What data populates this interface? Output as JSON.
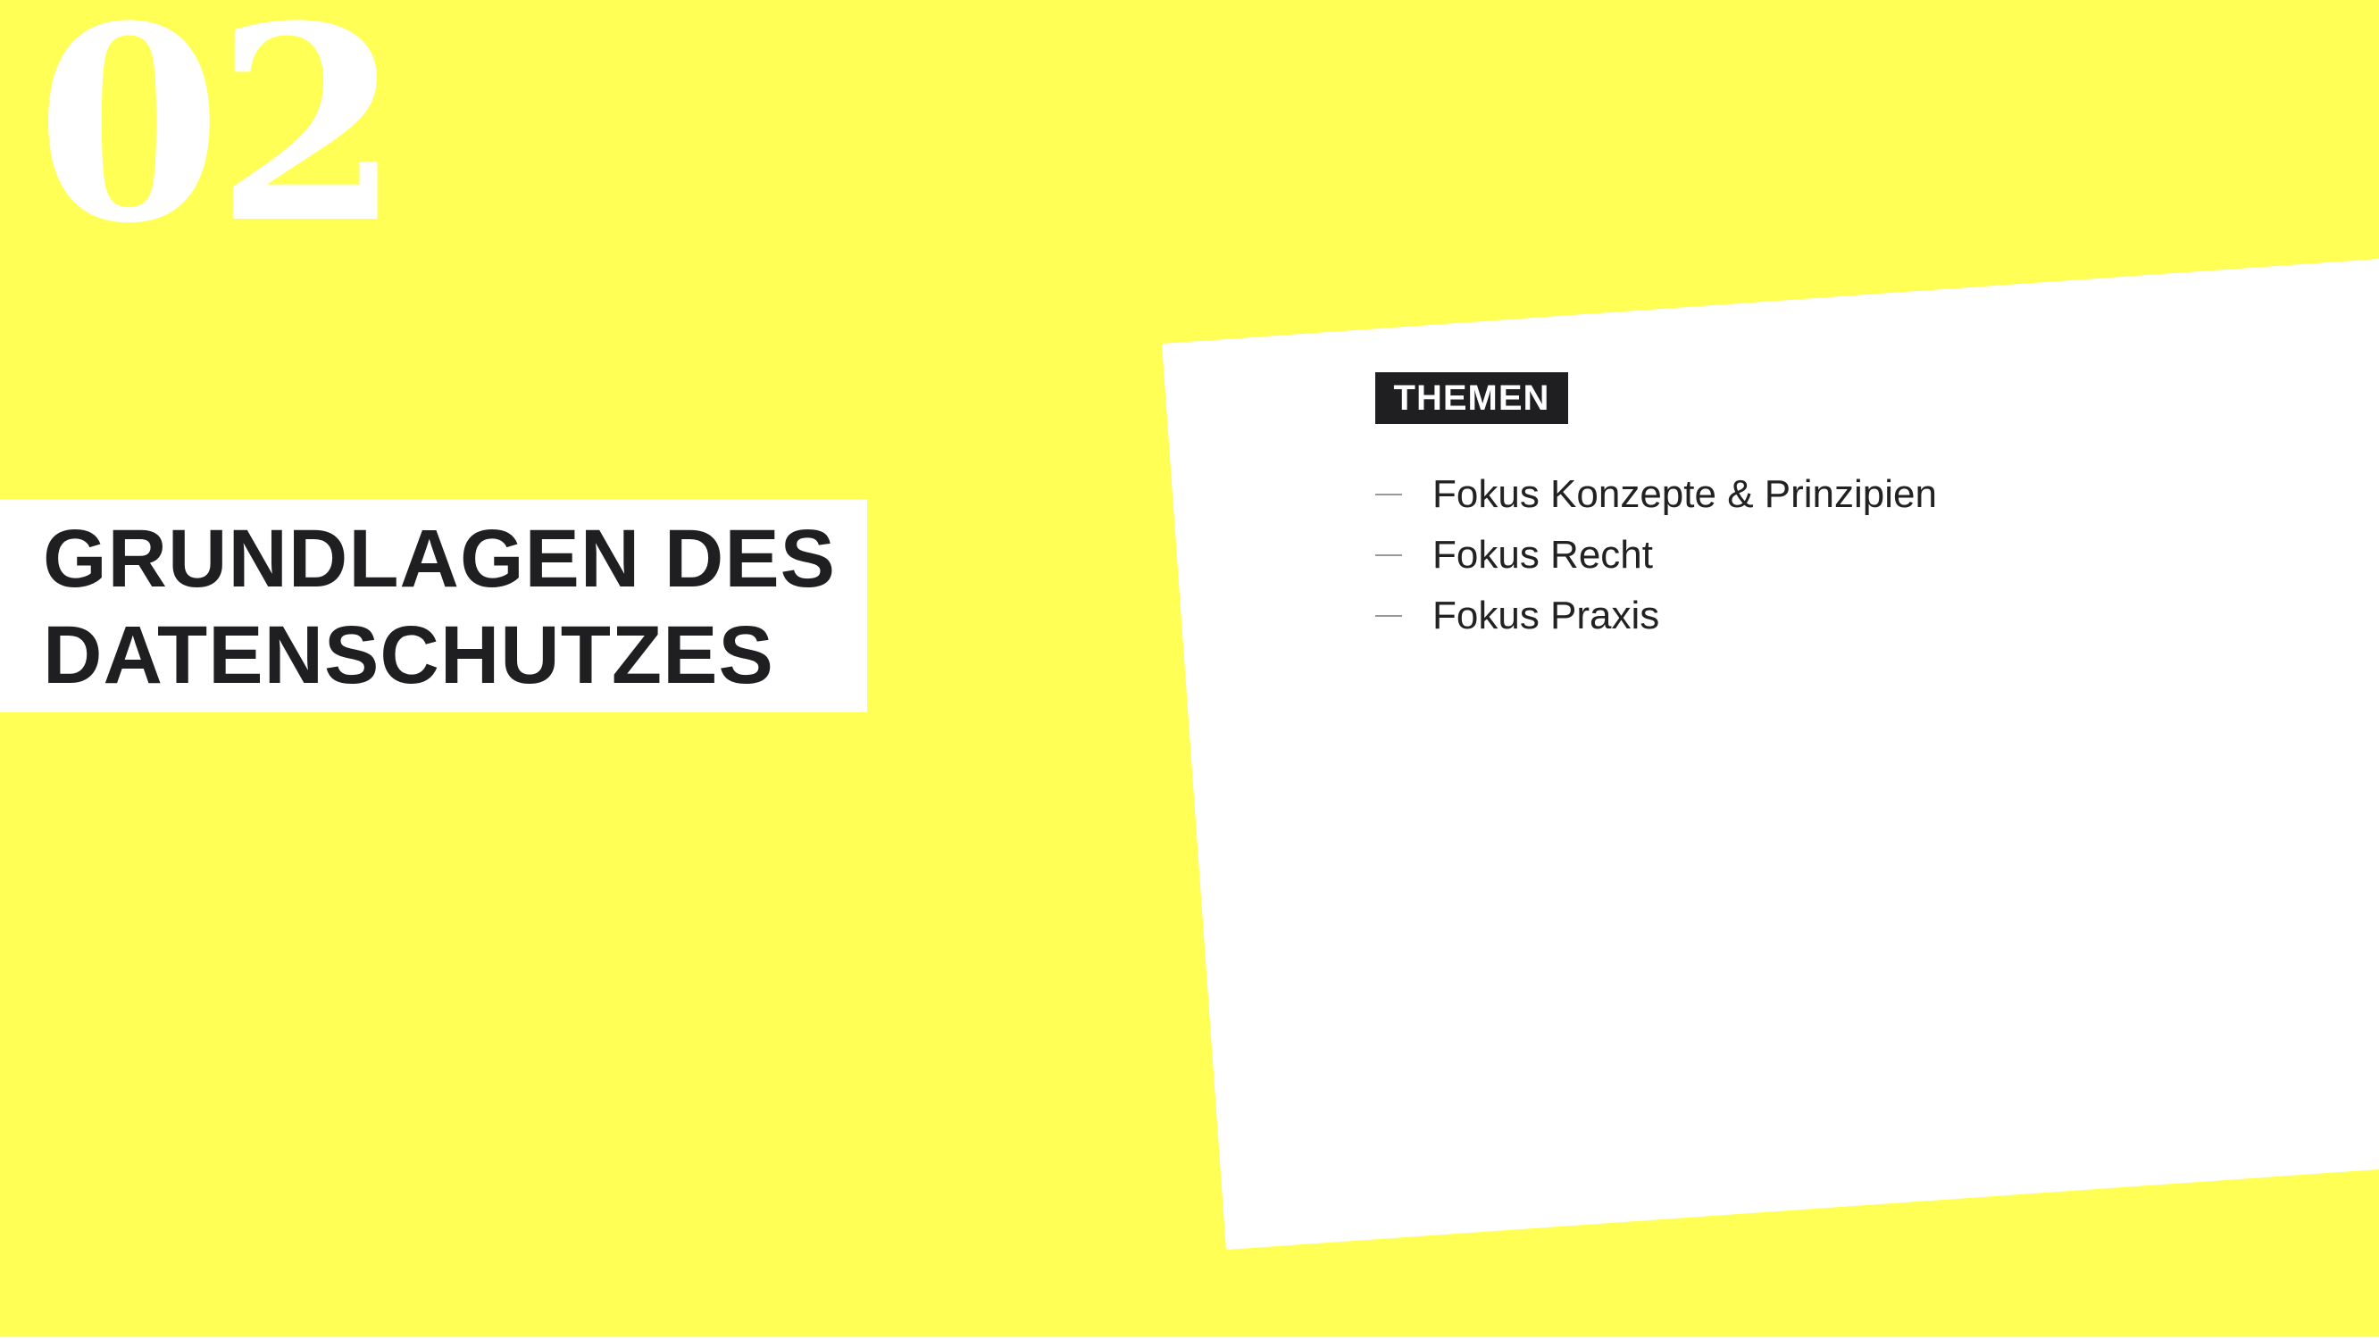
{
  "slide": {
    "section_number": "02",
    "title": "GRUNDLAGEN DES\nDATENSCHUTZES",
    "tag": "THEMEN",
    "topics": [
      "Fokus Konzepte & Prinzipien",
      "Fokus Recht",
      "Fokus Praxis"
    ]
  },
  "colors": {
    "background": "#ffff55",
    "panel": "#ffffff",
    "text_dark": "#1f1f21",
    "section_number": "#ffffff",
    "dash": "#999999"
  }
}
